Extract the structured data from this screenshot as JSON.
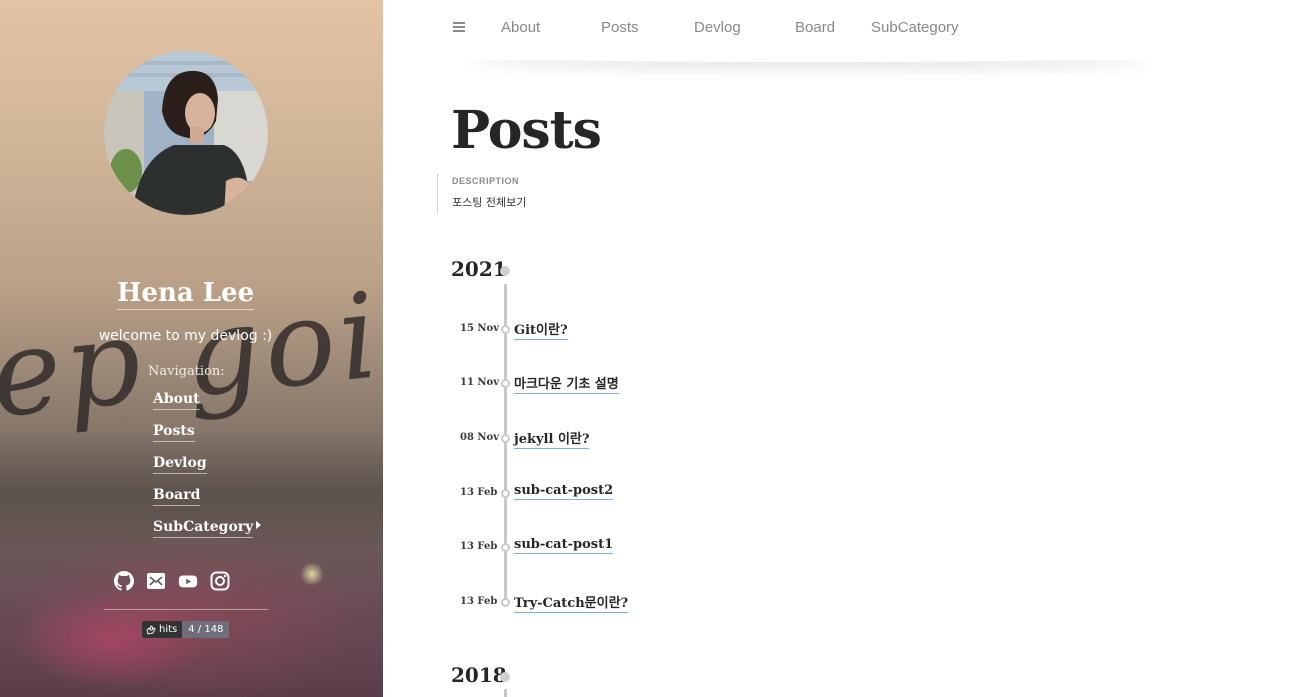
{
  "sidebar": {
    "background_script": "ep goin",
    "author_name": "Hena Lee",
    "tagline": "welcome to my devlog :)",
    "nav_label": "Navigation:",
    "nav_items": [
      {
        "label": "About"
      },
      {
        "label": "Posts"
      },
      {
        "label": "Devlog"
      },
      {
        "label": "Board"
      },
      {
        "label": "SubCategory",
        "has_submenu": true
      }
    ],
    "social_icons": [
      "github-icon",
      "mail-icon",
      "youtube-icon",
      "instagram-icon"
    ],
    "hits": {
      "label": "hits",
      "value": "4 / 148"
    }
  },
  "topbar": {
    "menu_icon": "hamburger-icon",
    "links": [
      "About",
      "Posts",
      "Devlog",
      "Board",
      "SubCategory"
    ]
  },
  "main": {
    "title": "Posts",
    "description_label": "DESCRIPTION",
    "description": "포스팅 전체보기",
    "years": [
      {
        "year": "2021",
        "posts": [
          {
            "date": "15 Nov",
            "title": "Git이란?"
          },
          {
            "date": "11 Nov",
            "title": "마크다운 기초 설명"
          },
          {
            "date": "08 Nov",
            "title": "jekyll 이란?"
          },
          {
            "date": "13 Feb",
            "title": "sub-cat-post2"
          },
          {
            "date": "13 Feb",
            "title": "sub-cat-post1"
          },
          {
            "date": "13 Feb",
            "title": "Try-Catch문이란?"
          }
        ]
      },
      {
        "year": "2018",
        "posts": []
      }
    ]
  },
  "colors": {
    "link_underline": "#7ab3d6",
    "timeline": "#c8c8c8",
    "heading": "#262626"
  }
}
